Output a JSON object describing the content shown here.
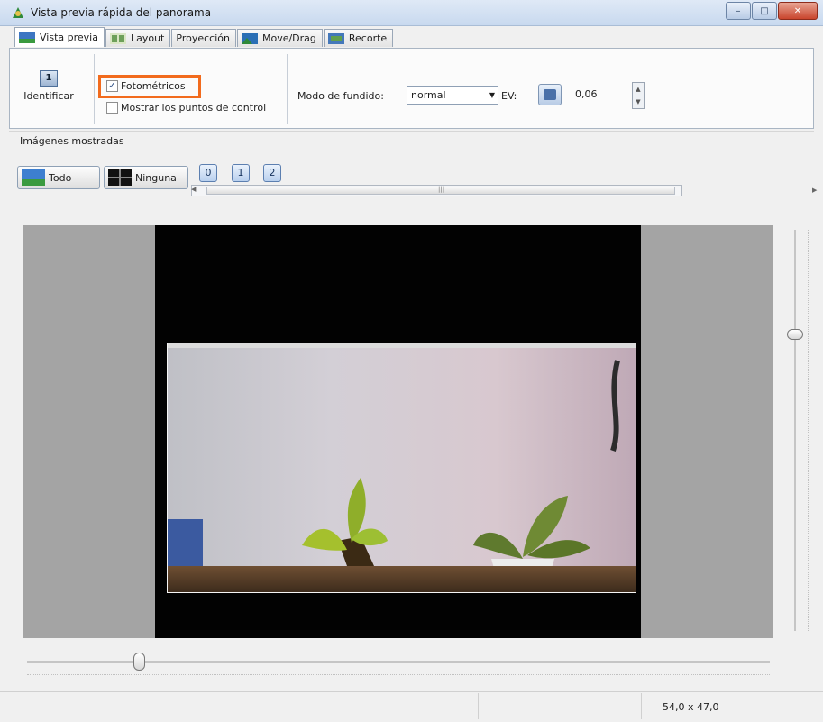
{
  "window": {
    "title": "Vista previa rápida del panorama"
  },
  "tabs": [
    {
      "label": "Vista previa",
      "icon": "preview-icon",
      "active": true
    },
    {
      "label": "Layout",
      "icon": "layout-icon",
      "active": false
    },
    {
      "label": "Proyección",
      "icon": "",
      "active": false
    },
    {
      "label": "Move/Drag",
      "icon": "move-drag-icon",
      "active": false
    },
    {
      "label": "Recorte",
      "icon": "crop-icon",
      "active": false
    }
  ],
  "toolbar": {
    "identify": {
      "label": "Identificar",
      "glyph": "1"
    },
    "photometric": {
      "label": "Fotométricos",
      "checked": true
    },
    "show_control_points": {
      "label": "Mostrar los puntos de control",
      "checked": false
    },
    "blend_mode_label": "Modo de fundido:",
    "blend_mode_value": "normal",
    "ev_label": "EV:",
    "ev_value": "0,06"
  },
  "images_shown": {
    "label": "Imágenes mostradas",
    "all_label": "Todo",
    "none_label": "Ninguna",
    "image_numbers": [
      "0",
      "1",
      "2"
    ],
    "scroll_center_glyph": "|||"
  },
  "preview": {
    "horizontal_slider_level": 0.15,
    "vertical_slider_level": 0.25
  },
  "status": {
    "fov": "54,0 x 47,0"
  },
  "colors": {
    "highlight": "#f26b1d"
  }
}
